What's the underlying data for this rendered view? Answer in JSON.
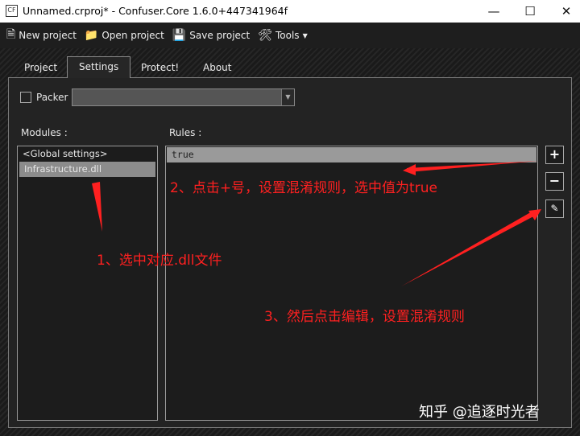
{
  "window": {
    "title": "Unnamed.crproj* - Confuser.Core 1.6.0+447341964f",
    "icon_text": "CF"
  },
  "toolbar": {
    "new_project": "New project",
    "open_project": "Open project",
    "save_project": "Save project",
    "tools": "Tools"
  },
  "tabs": [
    {
      "label": "Project"
    },
    {
      "label": "Settings"
    },
    {
      "label": "Protect!"
    },
    {
      "label": "About"
    }
  ],
  "settings": {
    "packer_label": "Packer :",
    "packer_value": "",
    "modules_label": "Modules :",
    "rules_label": "Rules :",
    "modules": [
      "<Global settings>",
      "Infrastructure.dll"
    ],
    "rules": [
      "true"
    ]
  },
  "annotations": {
    "a1": "1、选中对应.dll文件",
    "a2": "2、点击+号，设置混淆规则，选中值为true",
    "a3": "3、然后点击编辑，设置混淆规则"
  },
  "watermark": "知乎 @追逐时光者",
  "colors": {
    "annotation": "#ff2020"
  }
}
